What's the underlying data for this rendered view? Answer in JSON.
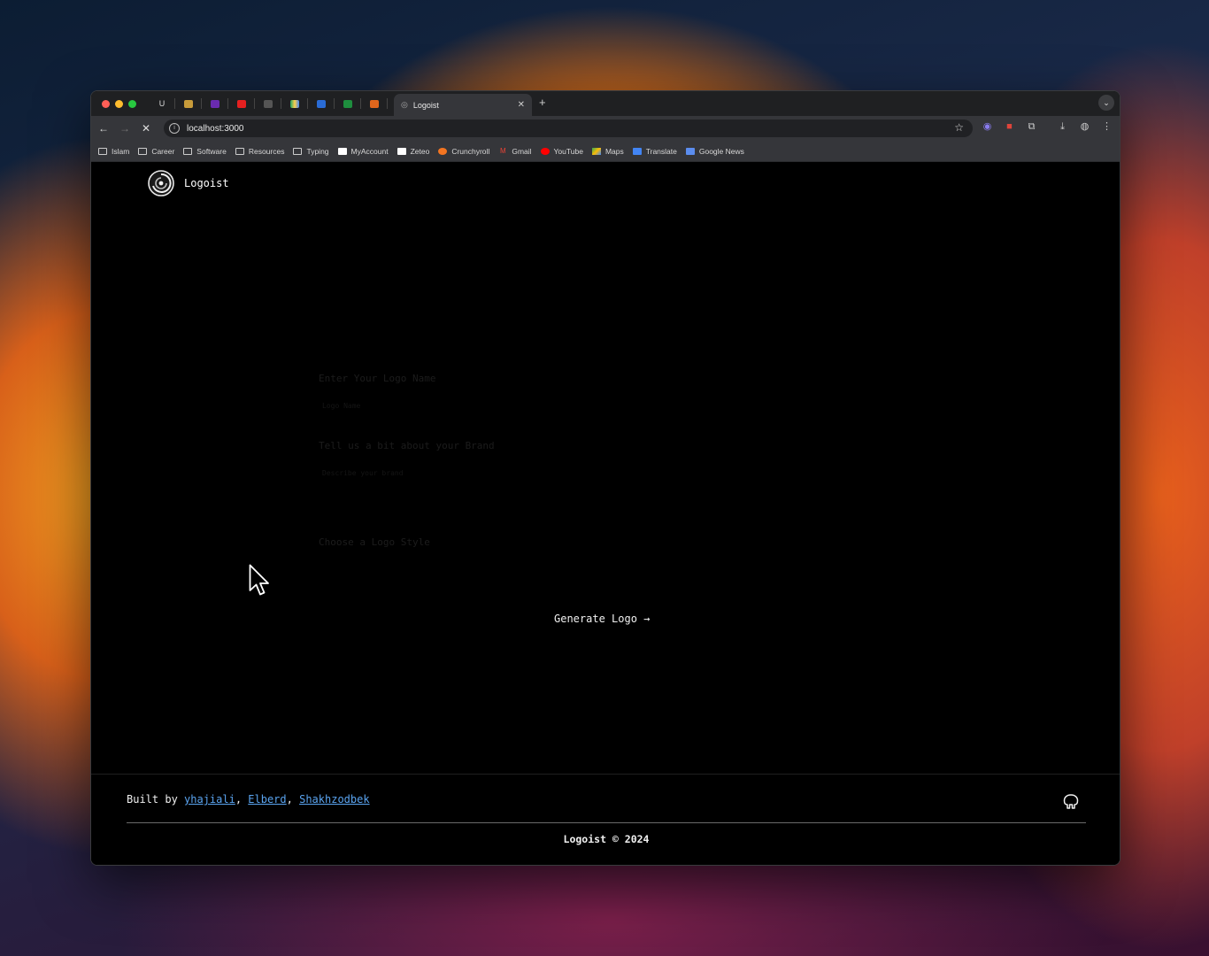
{
  "browser": {
    "active_tab_title": "Logoist",
    "mini_tabs": [
      "U",
      "",
      "",
      "",
      "",
      "",
      "",
      "",
      ""
    ],
    "address": "localhost:3000",
    "bookmarks": [
      {
        "label": "Islam",
        "icon": "folder-icon"
      },
      {
        "label": "Career",
        "icon": "folder-icon"
      },
      {
        "label": "Software",
        "icon": "folder-icon"
      },
      {
        "label": "Resources",
        "icon": "folder-icon"
      },
      {
        "label": "Typing",
        "icon": "folder-icon"
      },
      {
        "label": "MyAccount",
        "icon": "myaccount-icon"
      },
      {
        "label": "Zeteo",
        "icon": "zeteo-icon"
      },
      {
        "label": "Crunchyroll",
        "icon": "crunchyroll-icon"
      },
      {
        "label": "Gmail",
        "icon": "gmail-icon"
      },
      {
        "label": "YouTube",
        "icon": "youtube-icon"
      },
      {
        "label": "Maps",
        "icon": "maps-icon"
      },
      {
        "label": "Translate",
        "icon": "translate-icon"
      },
      {
        "label": "Google News",
        "icon": "google-news-icon"
      }
    ]
  },
  "app": {
    "brand_name": "Logoist",
    "form": {
      "name_label": "Enter Your Logo Name",
      "name_placeholder": "Logo Name",
      "brand_label": "Tell us a bit about your Brand",
      "brand_placeholder": "Describe your brand",
      "style_label": "Choose a Logo Style"
    },
    "generate_label": "Generate Logo →"
  },
  "footer": {
    "built_prefix": "Built by ",
    "authors": [
      "yhajiali",
      "Elberd",
      "Shakhzodbek"
    ],
    "sep": ", ",
    "copyright": "Logoist © 2024"
  },
  "colors": {
    "link": "#5aa4f0",
    "page_bg": "#000000",
    "chrome_toolbar": "#35363a"
  }
}
